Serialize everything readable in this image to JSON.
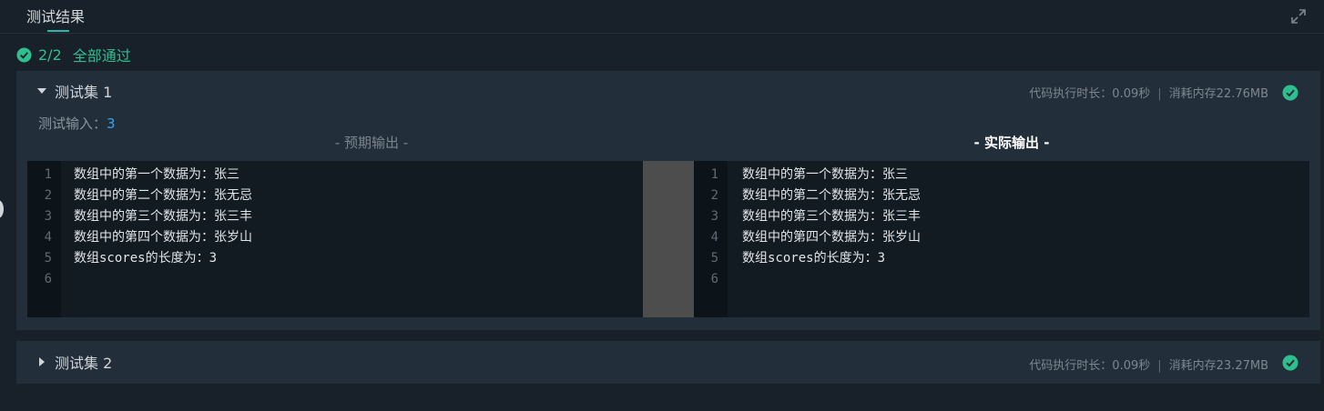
{
  "header": {
    "tab_label": "测试结果"
  },
  "summary": {
    "count": "2/2",
    "status": "全部通过"
  },
  "test_sets": [
    {
      "title": "测试集 1",
      "meta": {
        "time": "代码执行时长：0.09秒",
        "sep": "|",
        "memory": "消耗内存22.76MB"
      },
      "input_label": "测试输入：",
      "input_value": "3",
      "expected_label": "- 预期输出 -",
      "actual_label": "- 实际输出 -",
      "expected_lines": [
        {
          "num": "1",
          "text": "数组中的第一个数据为：张三"
        },
        {
          "num": "2",
          "text": "数组中的第二个数据为：张无忌"
        },
        {
          "num": "3",
          "text": "数组中的第三个数据为：张三丰"
        },
        {
          "num": "4",
          "text": "数组中的第四个数据为：张岁山"
        },
        {
          "num": "5",
          "text": "数组scores的长度为：3"
        },
        {
          "num": "6",
          "text": ""
        }
      ],
      "actual_lines": [
        {
          "num": "1",
          "text": "数组中的第一个数据为：张三"
        },
        {
          "num": "2",
          "text": "数组中的第二个数据为：张无忌"
        },
        {
          "num": "3",
          "text": "数组中的第三个数据为：张三丰"
        },
        {
          "num": "4",
          "text": "数组中的第四个数据为：张岁山"
        },
        {
          "num": "5",
          "text": "数组scores的长度为：3"
        },
        {
          "num": "6",
          "text": ""
        }
      ]
    },
    {
      "title": "测试集 2",
      "meta": {
        "time": "代码执行时长：0.09秒",
        "sep": "|",
        "memory": "消耗内存23.27MB"
      }
    }
  ],
  "icons": {
    "summary": "check-circle-icon",
    "expand": "expand-icon",
    "collapse_open": "caret-down-icon",
    "collapse_closed": "caret-right-icon",
    "pass": "check-circle-icon"
  },
  "colors": {
    "pass_green": "#2fbf8f",
    "input_value_blue": "#3aa0f0",
    "accent_underline": "#29b6a4"
  }
}
